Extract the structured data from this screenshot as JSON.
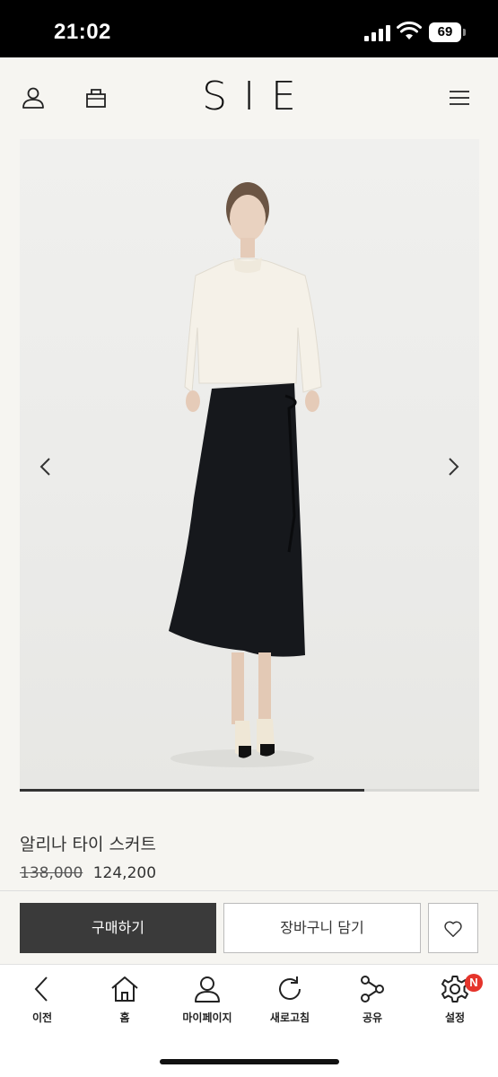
{
  "status_bar": {
    "time": "21:02",
    "battery": "69"
  },
  "header": {
    "brand": "SIE",
    "icons": [
      "user-icon",
      "bag-icon",
      "menu-icon"
    ]
  },
  "carousel": {
    "progress": 0.75,
    "arrows": [
      "chevron-left-icon",
      "chevron-right-icon"
    ]
  },
  "product": {
    "name": "알리나 타이 스커트",
    "original_price": "138,000",
    "sale_price": "124,200"
  },
  "actions": {
    "buy_label": "구매하기",
    "cart_label": "장바구니 담기",
    "wish_icon": "heart-icon"
  },
  "bottom_nav": {
    "items": [
      {
        "label": "이전",
        "icon": "back-icon"
      },
      {
        "label": "홈",
        "icon": "home-icon"
      },
      {
        "label": "마이페이지",
        "icon": "person-icon"
      },
      {
        "label": "새로고침",
        "icon": "refresh-icon"
      },
      {
        "label": "공유",
        "icon": "share-icon"
      },
      {
        "label": "설정",
        "icon": "gear-icon",
        "badge": "N"
      }
    ]
  },
  "colors": {
    "background": "#f6f5f1",
    "primary_button": "#3a3a3a",
    "badge": "#e5342b"
  }
}
